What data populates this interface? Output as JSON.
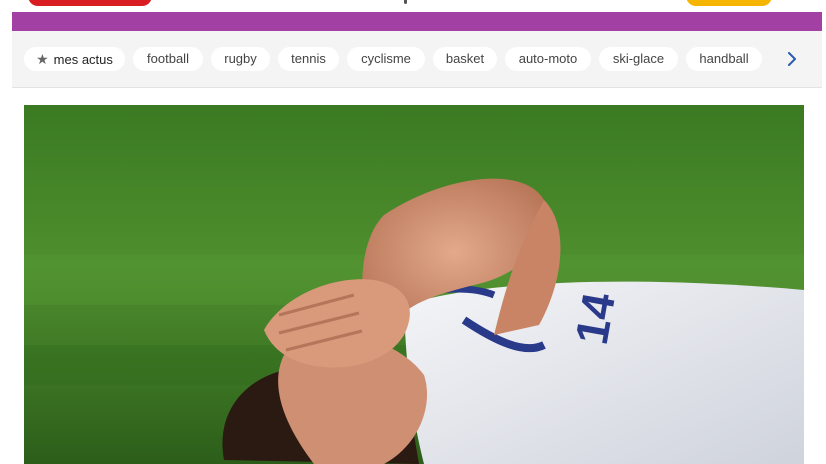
{
  "colors": {
    "accent_bar": "#a340a4",
    "brand_red": "#d81e22",
    "brand_yellow": "#f6b500"
  },
  "nav": {
    "chips": [
      {
        "label": "mes actus",
        "icon": "star-icon"
      },
      {
        "label": "football"
      },
      {
        "label": "rugby"
      },
      {
        "label": "tennis"
      },
      {
        "label": "cyclisme"
      },
      {
        "label": "basket"
      },
      {
        "label": "auto-moto"
      },
      {
        "label": "ski-glace"
      },
      {
        "label": "handball"
      }
    ],
    "next_icon": "chevron-right-icon"
  },
  "hero": {
    "jersey_number": "14"
  }
}
